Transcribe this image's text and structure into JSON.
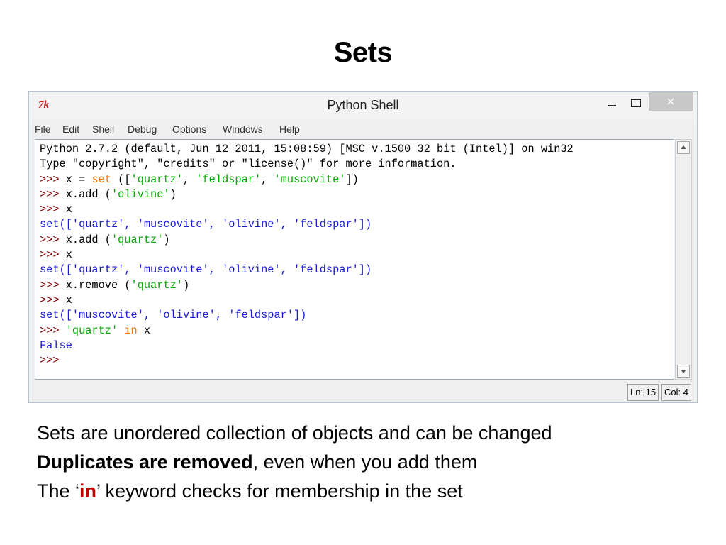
{
  "slide": {
    "title": "Sets"
  },
  "window": {
    "title": "Python Shell",
    "icon_text": "7k",
    "close_glyph": "×",
    "menu": [
      "File",
      "Edit",
      "Shell",
      "Debug",
      "Options",
      "Windows",
      "Help"
    ],
    "status": {
      "ln": "Ln: 15",
      "col": "Col: 4"
    }
  },
  "shell": {
    "lines": [
      [
        {
          "t": "Python 2.7.2 (default, Jun 12 2011, 15:08:59) [MSC v.1500 32 bit (Intel)] on win32",
          "c": ""
        }
      ],
      [
        {
          "t": "Type \"copyright\", \"credits\" or \"license()\" for more information.",
          "c": ""
        }
      ],
      [
        {
          "t": ">>> ",
          "c": "prompt"
        },
        {
          "t": "x = ",
          "c": ""
        },
        {
          "t": "set",
          "c": "kw"
        },
        {
          "t": " ([",
          "c": ""
        },
        {
          "t": "'quartz'",
          "c": "str"
        },
        {
          "t": ", ",
          "c": ""
        },
        {
          "t": "'feldspar'",
          "c": "str"
        },
        {
          "t": ", ",
          "c": ""
        },
        {
          "t": "'muscovite'",
          "c": "str"
        },
        {
          "t": "])",
          "c": ""
        }
      ],
      [
        {
          "t": ">>> ",
          "c": "prompt"
        },
        {
          "t": "x.add (",
          "c": ""
        },
        {
          "t": "'olivine'",
          "c": "str"
        },
        {
          "t": ")",
          "c": ""
        }
      ],
      [
        {
          "t": ">>> ",
          "c": "prompt"
        },
        {
          "t": "x",
          "c": ""
        }
      ],
      [
        {
          "t": "set(['quartz', 'muscovite', 'olivine', 'feldspar'])",
          "c": "out"
        }
      ],
      [
        {
          "t": ">>> ",
          "c": "prompt"
        },
        {
          "t": "x.add (",
          "c": ""
        },
        {
          "t": "'quartz'",
          "c": "str"
        },
        {
          "t": ")",
          "c": ""
        }
      ],
      [
        {
          "t": ">>> ",
          "c": "prompt"
        },
        {
          "t": "x",
          "c": ""
        }
      ],
      [
        {
          "t": "set(['quartz', 'muscovite', 'olivine', 'feldspar'])",
          "c": "out"
        }
      ],
      [
        {
          "t": ">>> ",
          "c": "prompt"
        },
        {
          "t": "x.remove (",
          "c": ""
        },
        {
          "t": "'quartz'",
          "c": "str"
        },
        {
          "t": ")",
          "c": ""
        }
      ],
      [
        {
          "t": ">>> ",
          "c": "prompt"
        },
        {
          "t": "x",
          "c": ""
        }
      ],
      [
        {
          "t": "set(['muscovite', 'olivine', 'feldspar'])",
          "c": "out"
        }
      ],
      [
        {
          "t": ">>> ",
          "c": "prompt"
        },
        {
          "t": "'quartz'",
          "c": "str"
        },
        {
          "t": " ",
          "c": ""
        },
        {
          "t": "in",
          "c": "kw"
        },
        {
          "t": " x",
          "c": ""
        }
      ],
      [
        {
          "t": "False",
          "c": "out"
        }
      ],
      [
        {
          "t": ">>>",
          "c": "prompt"
        }
      ]
    ]
  },
  "bullets": {
    "line1": "Sets are unordered collection of objects and can be changed",
    "line2_bold": "Duplicates are removed",
    "line2_rest": ", even when you add them",
    "line3_pre": "The ‘",
    "line3_kw": "in",
    "line3_post": "’ keyword checks for membership in the set"
  },
  "colors": {
    "prompt": "#800000",
    "string": "#00aa00",
    "keyword": "#ff7700",
    "output": "#1a1ad6",
    "highlight": "#c00000"
  }
}
